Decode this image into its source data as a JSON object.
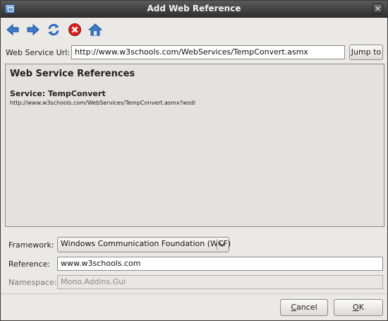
{
  "window": {
    "title": "Add Web Reference"
  },
  "toolbar": {
    "buttons": [
      "back-arrow-icon",
      "forward-arrow-icon",
      "refresh-icon",
      "stop-icon",
      "home-icon"
    ]
  },
  "url": {
    "label": "Web Service Url:",
    "value": "http://www.w3schools.com/WebServices/TempConvert.asmx",
    "jump_label": "Jump to"
  },
  "references": {
    "heading": "Web Service References",
    "service": "Service: TempConvert",
    "wsdl": "http://www.w3schools.com/WebServices/TempConvert.asmx?wsdl"
  },
  "form": {
    "framework_label": "Framework:",
    "framework_value": "Windows Communication Foundation (WCF)",
    "reference_label": "Reference:",
    "reference_value": "www.w3schools.com",
    "namespace_label": "Namespace:",
    "namespace_value": "Mono.Addins.Gui"
  },
  "buttons": {
    "cancel_pre": "",
    "cancel_mnemonic": "C",
    "cancel_post": "ancel",
    "ok_pre": "",
    "ok_mnemonic": "O",
    "ok_post": "K"
  },
  "colors": {
    "titlebar": "#3a3a3a",
    "arrow_blue": "#3c79c9",
    "stop_red": "#d8211e",
    "panel": "#e4e2de"
  }
}
